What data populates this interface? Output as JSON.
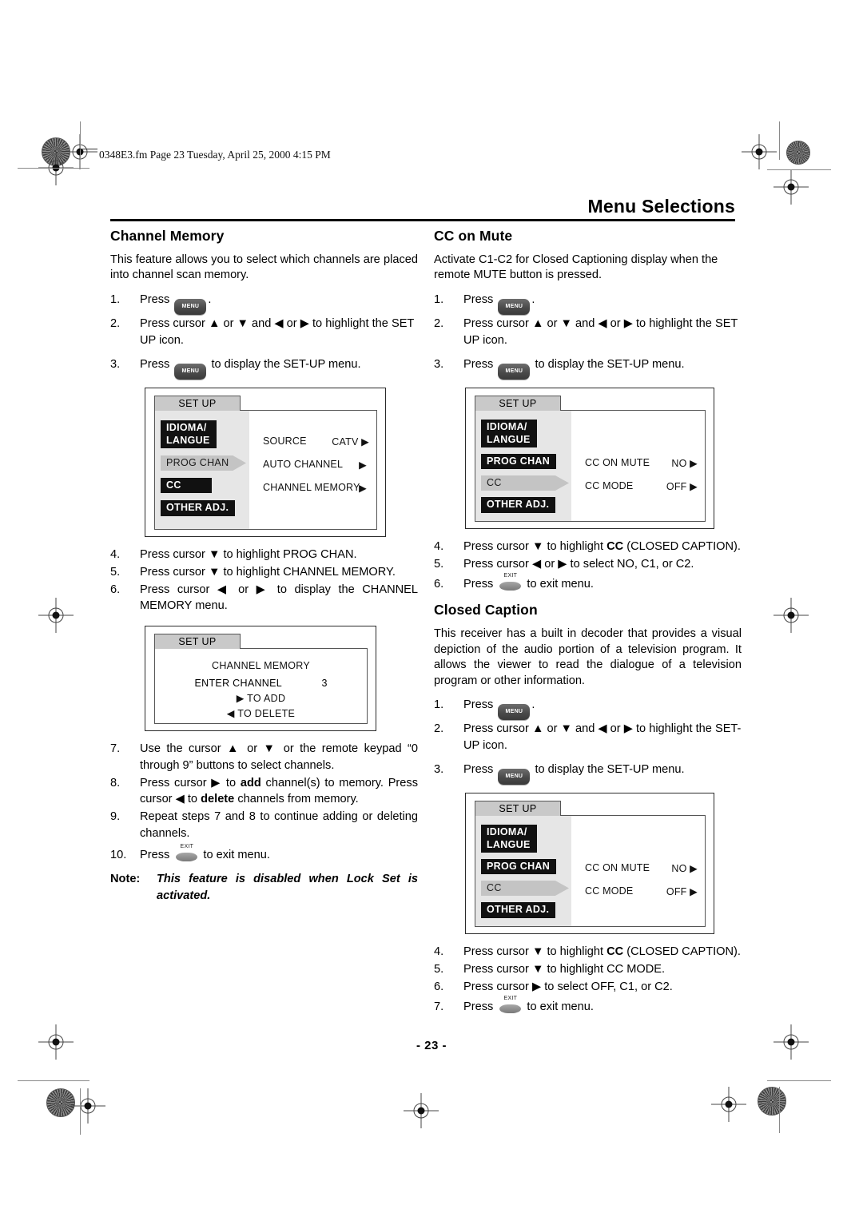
{
  "page": {
    "slug": "0348E3.fm  Page 23  Tuesday, April 25, 2000  4:15 PM",
    "running_head": "Menu Selections",
    "page_number": "- 23 -"
  },
  "buttons": {
    "menu_label": "MENU",
    "exit_label": "EXIT"
  },
  "left_column": {
    "section_title": "Channel Memory",
    "intro": "This feature allows you to select which channels are placed into channel scan memory.",
    "steps_1_3": [
      {
        "num": "1.",
        "pre": "Press",
        "button": "menu",
        "post": "."
      },
      {
        "num": "2.",
        "pre": "Press cursor ▲ or ▼ and ◀ or ▶ to highlight the SET UP icon.",
        "button": "",
        "post": ""
      },
      {
        "num": "3.",
        "pre": "Press",
        "button": "menu",
        "post": "to display the SET-UP menu."
      }
    ],
    "steps_4_6": [
      {
        "num": "4.",
        "text": "Press cursor ▼ to highlight PROG CHAN."
      },
      {
        "num": "5.",
        "text": "Press cursor  ▼ to highlight CHANNEL MEMORY."
      },
      {
        "num": "6.",
        "text": "Press cursor ◀ or ▶ to display the CHANNEL MEMORY menu."
      }
    ],
    "steps_7_10": [
      {
        "num": "7.",
        "text": "Use the cursor ▲ or ▼ or the remote keypad “0 through 9” buttons to select channels."
      },
      {
        "num": "8.",
        "text": "Press cursor ▶ to add channel(s) to memory. Press cursor ◀ to delete channels from memory."
      },
      {
        "num": "9.",
        "text": "Repeat steps 7 and 8 to continue adding or deleting channels."
      },
      {
        "num": "10.",
        "text": "Press  to exit menu."
      }
    ],
    "note": {
      "label": "Note:",
      "text": "This feature is disabled when Lock Set is activated."
    }
  },
  "right_column": {
    "cc_on_mute": {
      "section_title": "CC on Mute",
      "intro": "Activate C1-C2 for Closed Captioning display when the remote MUTE button is pressed.",
      "steps_4_6": [
        {
          "num": "4.",
          "text": "Press cursor ▼ to highlight CC (CLOSED CAPTION)."
        },
        {
          "num": "5.",
          "text": "Press cursor ◀ or ▶ to select NO, C1, or C2."
        },
        {
          "num": "6.",
          "text": "Press  to exit menu."
        }
      ]
    },
    "closed_caption": {
      "section_title": "Closed Caption",
      "intro": "This receiver has a built in decoder that provides a visual depiction of the audio portion of a television program. It allows the viewer to read the dialogue of a television program or other information.",
      "steps_4_7": [
        {
          "num": "4.",
          "text": "Press cursor ▼ to highlight CC (CLOSED CAPTION)."
        },
        {
          "num": "5.",
          "text": "Press cursor ▼ to highlight CC MODE."
        },
        {
          "num": "6.",
          "text": "Press cursor ▶ to select OFF, C1, or C2."
        },
        {
          "num": "7.",
          "text": "Press  to exit menu."
        }
      ]
    }
  },
  "osd_setup_prog_chan": {
    "tab": "SET UP",
    "menu_items": [
      {
        "label": "IDIOMA/\nLANGUE",
        "selected": false
      },
      {
        "label": "PROG CHAN",
        "selected": true
      },
      {
        "label": "CC",
        "selected": false
      },
      {
        "label": "OTHER ADJ.",
        "selected": false
      }
    ],
    "rows": [
      {
        "label": "SOURCE",
        "value": "CATV ▶"
      },
      {
        "label": "AUTO CHANNEL",
        "value": "▶"
      },
      {
        "label": "CHANNEL MEMORY",
        "value": "▶"
      }
    ]
  },
  "osd_channel_memory": {
    "tab": "SET UP",
    "lines": [
      "CHANNEL MEMORY",
      "ENTER CHANNEL            3",
      "▶  TO ADD",
      "◀  TO DELETE"
    ],
    "enter_channel_label": "ENTER CHANNEL",
    "enter_channel_value": "3",
    "title_line": "CHANNEL MEMORY",
    "add_line": "▶  TO ADD",
    "delete_line": "◀  TO DELETE"
  },
  "osd_setup_cc": {
    "tab": "SET UP",
    "menu_items": [
      {
        "label": "IDIOMA/\nLANGUE",
        "selected": false
      },
      {
        "label": "PROG CHAN",
        "selected": false
      },
      {
        "label": "CC",
        "selected": true
      },
      {
        "label": "OTHER ADJ.",
        "selected": false
      }
    ],
    "rows": [
      {
        "label": "CC ON MUTE",
        "value": "NO ▶"
      },
      {
        "label": "CC MODE",
        "value": "OFF ▶"
      }
    ]
  }
}
